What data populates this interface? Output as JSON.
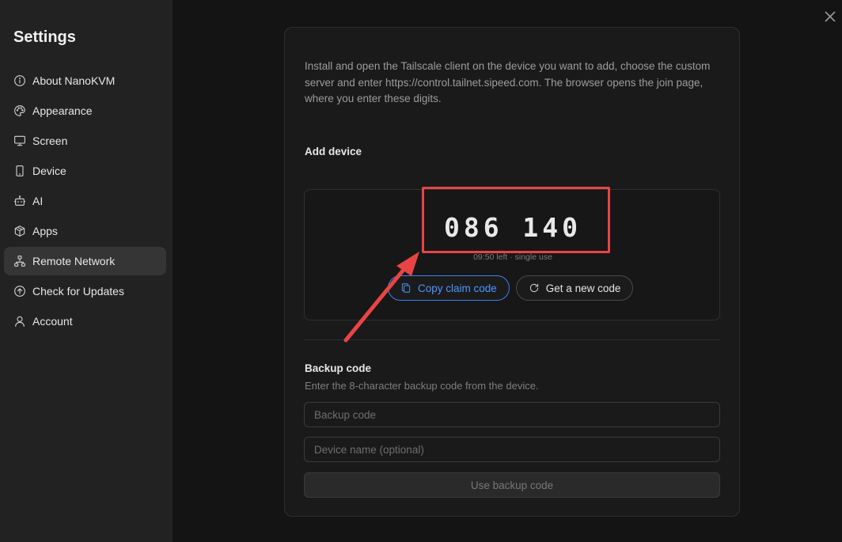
{
  "sidebar": {
    "title": "Settings",
    "items": [
      {
        "label": "About NanoKVM",
        "icon": "info-icon"
      },
      {
        "label": "Appearance",
        "icon": "palette-icon"
      },
      {
        "label": "Screen",
        "icon": "monitor-icon"
      },
      {
        "label": "Device",
        "icon": "smartphone-icon"
      },
      {
        "label": "AI",
        "icon": "bot-icon"
      },
      {
        "label": "Apps",
        "icon": "package-icon"
      },
      {
        "label": "Remote Network",
        "icon": "network-icon",
        "active": true
      },
      {
        "label": "Check for Updates",
        "icon": "arrow-up-circle-icon"
      },
      {
        "label": "Account",
        "icon": "user-icon"
      }
    ]
  },
  "panel": {
    "intro": "Install and open the Tailscale client on the device you want to add, choose the custom server and enter https://control.tailnet.sipeed.com. The browser opens the join page, where you enter these digits.",
    "add_device": {
      "title": "Add device",
      "code": "086 140",
      "meta": "09:50 left · single use",
      "copy_label": "Copy claim code",
      "new_label": "Get a new code"
    },
    "backup": {
      "title": "Backup code",
      "description": "Enter the 8-character backup code from the device.",
      "code_placeholder": "Backup code",
      "code_value": "",
      "name_placeholder": "Device name (optional)",
      "name_value": "",
      "submit_label": "Use backup code"
    }
  },
  "colors": {
    "accent": "#3b82f6",
    "annotation": "#e94444",
    "sidebar_bg": "#222222",
    "page_bg": "#141414"
  }
}
